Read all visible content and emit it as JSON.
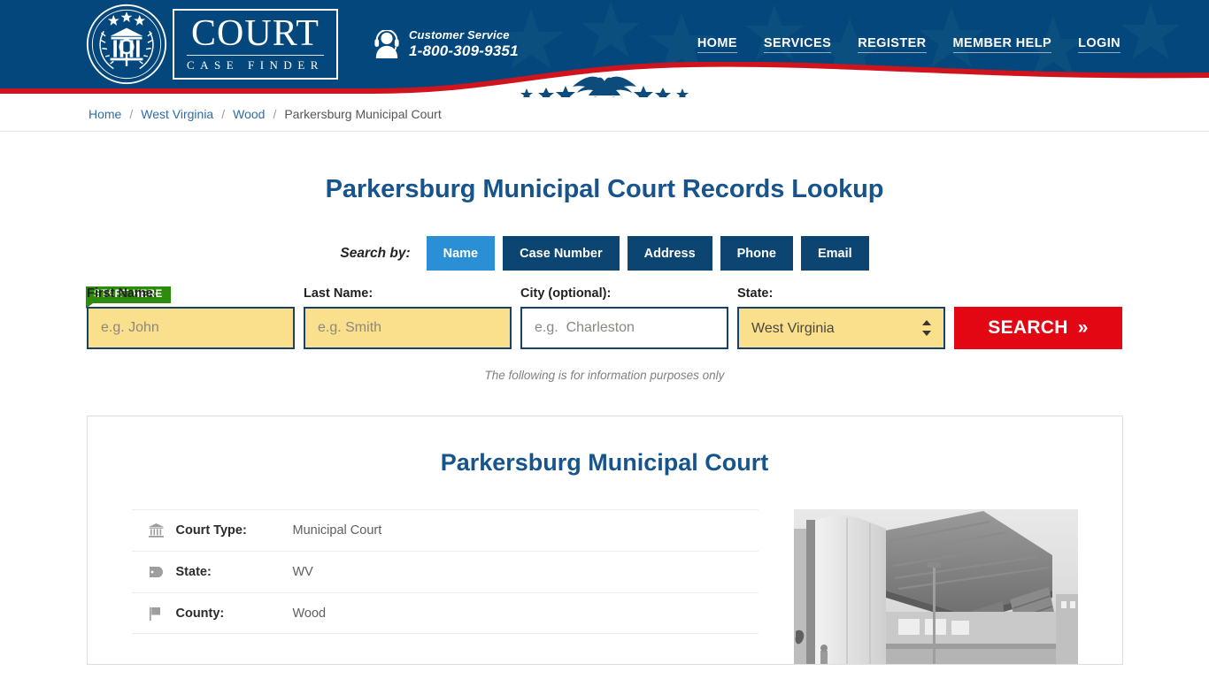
{
  "header": {
    "logo": {
      "seal_icon": "court-seal-icon",
      "primary": "COURT",
      "secondary": "CASE FINDER"
    },
    "customer_service": {
      "icon": "headset-support-icon",
      "label": "Customer Service",
      "phone": "1-800-309-9351"
    },
    "nav": [
      {
        "label": "HOME"
      },
      {
        "label": "SERVICES"
      },
      {
        "label": "REGISTER"
      },
      {
        "label": "MEMBER HELP"
      },
      {
        "label": "LOGIN"
      }
    ],
    "colors": {
      "navy": "#04477c",
      "red": "#d0141e",
      "white": "#ffffff"
    }
  },
  "breadcrumb": {
    "items": [
      {
        "label": "Home",
        "link": true
      },
      {
        "label": "West Virginia",
        "link": true
      },
      {
        "label": "Wood",
        "link": true
      },
      {
        "label": "Parkersburg Municipal Court",
        "link": false
      }
    ],
    "separator": "/"
  },
  "main": {
    "page_title": "Parkersburg Municipal Court Records Lookup",
    "search_by_label": "Search by:",
    "tabs": [
      {
        "label": "Name",
        "active": true
      },
      {
        "label": "Case Number",
        "active": false
      },
      {
        "label": "Address",
        "active": false
      },
      {
        "label": "Phone",
        "active": false
      },
      {
        "label": "Email",
        "active": false
      }
    ],
    "start_here_badge": "START HERE",
    "form": {
      "first_name": {
        "label": "First Name:",
        "placeholder": "e.g. John",
        "value": ""
      },
      "last_name": {
        "label": "Last Name:",
        "placeholder": "e.g. Smith",
        "value": ""
      },
      "city": {
        "label": "City (optional):",
        "placeholder": "e.g.  Charleston",
        "value": ""
      },
      "state": {
        "label": "State:",
        "value": "West Virginia"
      },
      "search_button": "SEARCH",
      "search_button_chevron": "»"
    },
    "note": "The following is for information purposes only"
  },
  "card": {
    "title": "Parkersburg Municipal Court",
    "details": [
      {
        "icon": "bank-icon",
        "label": "Court Type:",
        "value": "Municipal Court"
      },
      {
        "icon": "tag-icon",
        "label": "State:",
        "value": "WV"
      },
      {
        "icon": "flag-icon",
        "label": "County:",
        "value": "Wood"
      }
    ],
    "photo": {
      "name": "courthouse-photo",
      "alt": "Courthouse building"
    }
  }
}
